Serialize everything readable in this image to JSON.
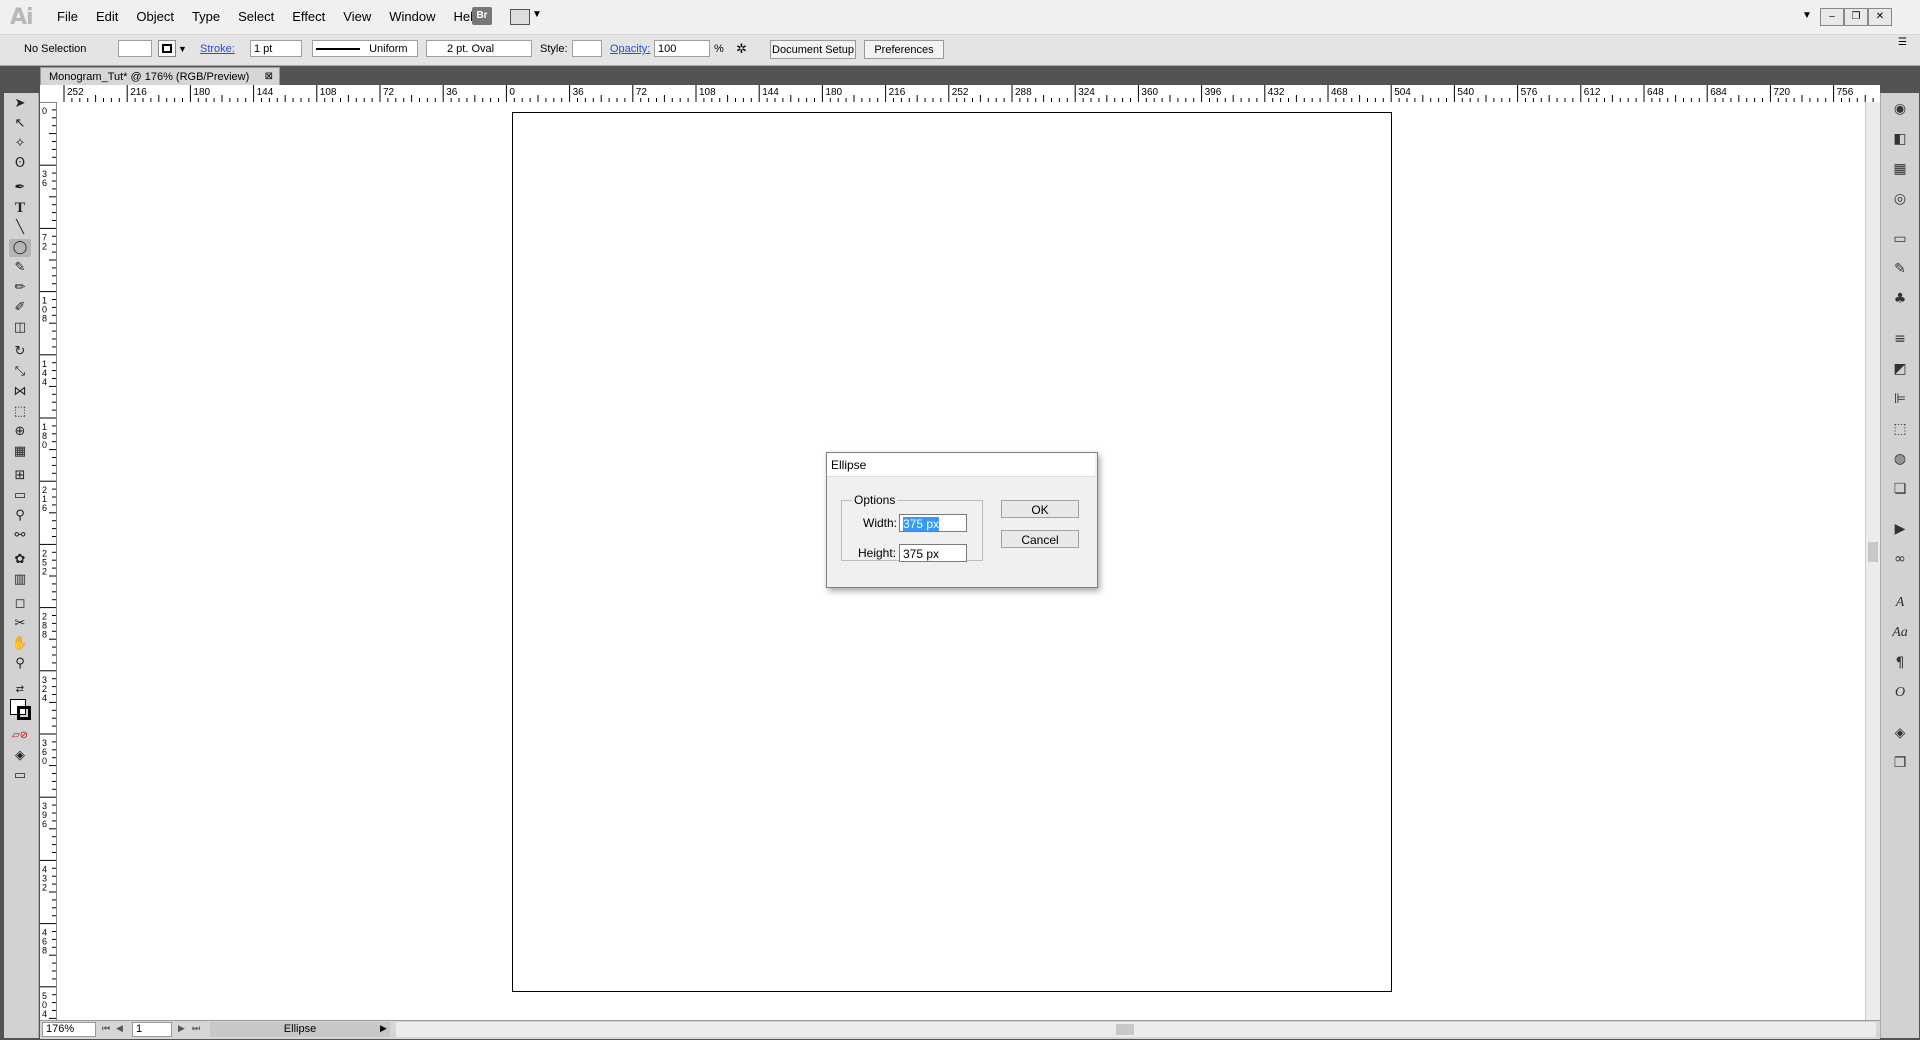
{
  "app": {
    "logo": "Ai"
  },
  "menu": [
    "File",
    "Edit",
    "Object",
    "Type",
    "Select",
    "Effect",
    "View",
    "Window",
    "Help"
  ],
  "bridge_label": "Br",
  "controlbar": {
    "selection": "No Selection",
    "stroke_label": "Stroke:",
    "stroke_weight": "1 pt",
    "stroke_profile": "Uniform",
    "brush": "2 pt. Oval",
    "style_label": "Style:",
    "opacity_label": "Opacity:",
    "opacity_value": "100",
    "percent": "%",
    "document_setup": "Document Setup",
    "preferences": "Preferences"
  },
  "document": {
    "tab_title": "Monogram_Tut* @ 176% (RGB/Preview)"
  },
  "ruler": {
    "h_labels": [
      "252",
      "216",
      "180",
      "144",
      "108",
      "72",
      "36",
      "0",
      "36",
      "72",
      "108",
      "144",
      "180",
      "216",
      "252",
      "288",
      "324",
      "360",
      "396",
      "432",
      "468",
      "504",
      "540",
      "576",
      "612",
      "648",
      "684",
      "720",
      "756"
    ],
    "v_labels": [
      "0",
      "36",
      "72",
      "108",
      "144",
      "180",
      "216",
      "252",
      "288",
      "324",
      "360",
      "396",
      "432",
      "468",
      "504"
    ]
  },
  "status": {
    "zoom": "176%",
    "page": "1",
    "tool": "Ellipse"
  },
  "dialog": {
    "title": "Ellipse",
    "group_label": "Options",
    "width_label": "Width:",
    "width_value": "375 px",
    "height_label": "Height:",
    "height_value": "375 px",
    "ok": "OK",
    "cancel": "Cancel"
  },
  "colors": {
    "selection_highlight": "#3399ff",
    "link_blue": "#2a4cd8",
    "workspace": "#535353"
  }
}
